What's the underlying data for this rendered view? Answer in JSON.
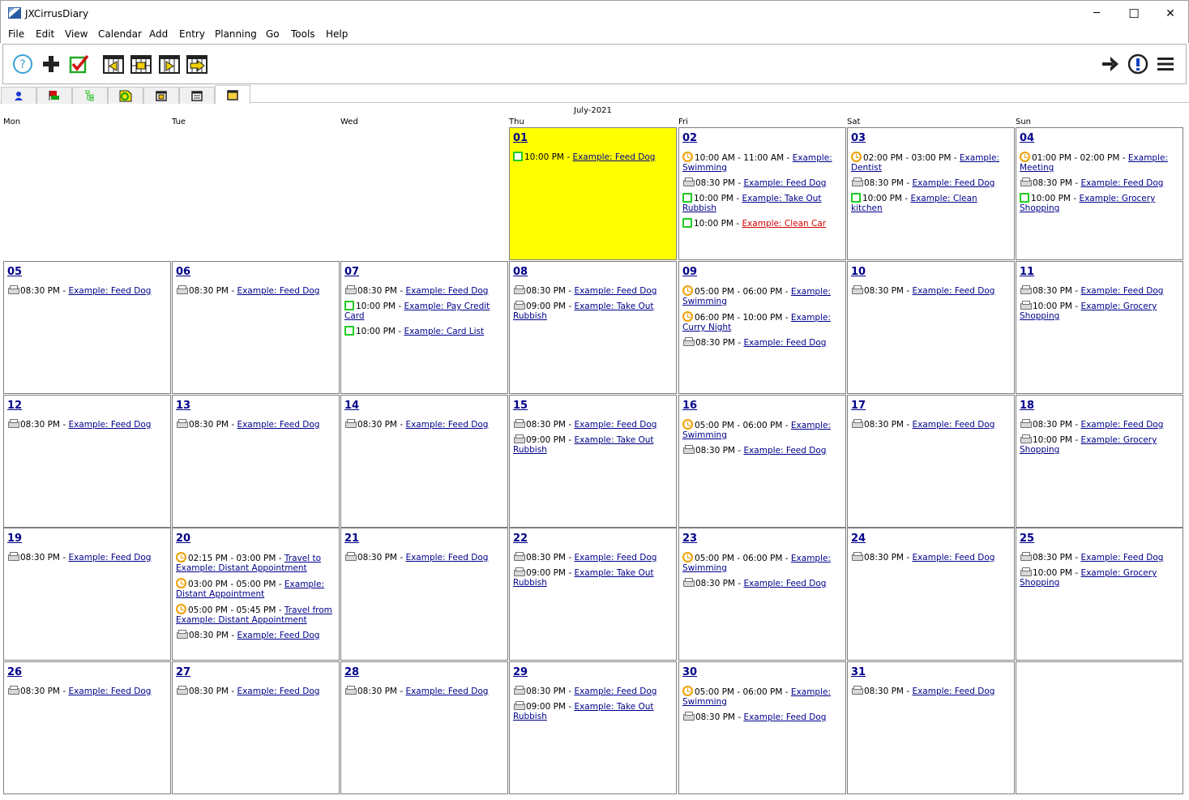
{
  "window": {
    "title": "JXCirrusDiary",
    "minimize": "─",
    "maximize": "☐",
    "close": "✕"
  },
  "menu": [
    "File",
    "Edit",
    "View",
    "Calendar",
    "Add",
    "Entry",
    "Planning",
    "Go",
    "Tools",
    "Help"
  ],
  "toolbar": {
    "left": [
      "help-icon",
      "add-icon",
      "check-icon",
      "week-back-icon",
      "week-calendar-icon",
      "week-forward-icon",
      "go-today-icon"
    ],
    "right": [
      "arrow-right-icon",
      "alert-icon",
      "menu-icon"
    ]
  },
  "tabs": [
    "person-icon",
    "flag-icon",
    "tree-icon",
    "note-icon",
    "day-icon",
    "week-icon",
    "month-icon"
  ],
  "calendar": {
    "month_label": "July-2021",
    "day_names": [
      "Mon",
      "Tue",
      "Wed",
      "Thu",
      "Fri",
      "Sat",
      "Sun"
    ],
    "today": "01",
    "cells": [
      {
        "col": 3,
        "row": 0,
        "day": "01",
        "events": [
          {
            "icon": "check",
            "time": "10:00 PM - ",
            "title": "Example: Feed Dog"
          }
        ]
      },
      {
        "col": 4,
        "row": 0,
        "day": "02",
        "events": [
          {
            "icon": "clock",
            "time": "10:00 AM - 11:00 AM - ",
            "title": "Example: Swimming"
          },
          {
            "icon": "printer",
            "time": "08:30 PM - ",
            "title": "Example: Feed Dog"
          },
          {
            "icon": "check",
            "time": "10:00 PM - ",
            "title": "Example: Take Out Rubbish"
          },
          {
            "icon": "check",
            "time": "10:00 PM - ",
            "title": "Example: Clean Car",
            "red": true
          }
        ]
      },
      {
        "col": 5,
        "row": 0,
        "day": "03",
        "events": [
          {
            "icon": "clock",
            "time": "02:00 PM - 03:00 PM - ",
            "title": "Example: Dentist"
          },
          {
            "icon": "printer",
            "time": "08:30 PM - ",
            "title": "Example: Feed Dog"
          },
          {
            "icon": "check",
            "time": "10:00 PM - ",
            "title": "Example: Clean kitchen"
          }
        ]
      },
      {
        "col": 6,
        "row": 0,
        "day": "04",
        "events": [
          {
            "icon": "clock",
            "time": "01:00 PM - 02:00 PM - ",
            "title": "Example: Meeting"
          },
          {
            "icon": "printer",
            "time": "08:30 PM - ",
            "title": "Example: Feed Dog"
          },
          {
            "icon": "check",
            "time": "10:00 PM - ",
            "title": "Example: Grocery Shopping"
          }
        ]
      },
      {
        "col": 0,
        "row": 1,
        "day": "05",
        "events": [
          {
            "icon": "printer",
            "time": "08:30 PM - ",
            "title": "Example: Feed Dog"
          }
        ]
      },
      {
        "col": 1,
        "row": 1,
        "day": "06",
        "events": [
          {
            "icon": "printer",
            "time": "08:30 PM - ",
            "title": "Example: Feed Dog"
          }
        ]
      },
      {
        "col": 2,
        "row": 1,
        "day": "07",
        "events": [
          {
            "icon": "printer",
            "time": "08:30 PM - ",
            "title": "Example: Feed Dog"
          },
          {
            "icon": "check",
            "time": "10:00 PM - ",
            "title": "Example: Pay Credit Card"
          },
          {
            "icon": "check",
            "time": "10:00 PM - ",
            "title": "Example: Card List"
          }
        ]
      },
      {
        "col": 3,
        "row": 1,
        "day": "08",
        "events": [
          {
            "icon": "printer",
            "time": "08:30 PM - ",
            "title": "Example: Feed Dog"
          },
          {
            "icon": "printer",
            "time": "09:00 PM - ",
            "title": "Example: Take Out Rubbish"
          }
        ]
      },
      {
        "col": 4,
        "row": 1,
        "day": "09",
        "events": [
          {
            "icon": "clock",
            "time": "05:00 PM - 06:00 PM - ",
            "title": "Example: Swimming"
          },
          {
            "icon": "clock",
            "time": "06:00 PM - 10:00 PM - ",
            "title": "Example: Curry Night"
          },
          {
            "icon": "printer",
            "time": "08:30 PM - ",
            "title": "Example: Feed Dog"
          }
        ]
      },
      {
        "col": 5,
        "row": 1,
        "day": "10",
        "events": [
          {
            "icon": "printer",
            "time": "08:30 PM - ",
            "title": "Example: Feed Dog"
          }
        ]
      },
      {
        "col": 6,
        "row": 1,
        "day": "11",
        "events": [
          {
            "icon": "printer",
            "time": "08:30 PM - ",
            "title": "Example: Feed Dog"
          },
          {
            "icon": "printer",
            "time": "10:00 PM - ",
            "title": "Example: Grocery Shopping"
          }
        ]
      },
      {
        "col": 0,
        "row": 2,
        "day": "12",
        "events": [
          {
            "icon": "printer",
            "time": "08:30 PM - ",
            "title": "Example: Feed Dog"
          }
        ]
      },
      {
        "col": 1,
        "row": 2,
        "day": "13",
        "events": [
          {
            "icon": "printer",
            "time": "08:30 PM - ",
            "title": "Example: Feed Dog"
          }
        ]
      },
      {
        "col": 2,
        "row": 2,
        "day": "14",
        "events": [
          {
            "icon": "printer",
            "time": "08:30 PM - ",
            "title": "Example: Feed Dog"
          }
        ]
      },
      {
        "col": 3,
        "row": 2,
        "day": "15",
        "events": [
          {
            "icon": "printer",
            "time": "08:30 PM - ",
            "title": "Example: Feed Dog"
          },
          {
            "icon": "printer",
            "time": "09:00 PM - ",
            "title": "Example: Take Out Rubbish"
          }
        ]
      },
      {
        "col": 4,
        "row": 2,
        "day": "16",
        "events": [
          {
            "icon": "clock",
            "time": "05:00 PM - 06:00 PM - ",
            "title": "Example: Swimming"
          },
          {
            "icon": "printer",
            "time": "08:30 PM - ",
            "title": "Example: Feed Dog"
          }
        ]
      },
      {
        "col": 5,
        "row": 2,
        "day": "17",
        "events": [
          {
            "icon": "printer",
            "time": "08:30 PM - ",
            "title": "Example: Feed Dog"
          }
        ]
      },
      {
        "col": 6,
        "row": 2,
        "day": "18",
        "events": [
          {
            "icon": "printer",
            "time": "08:30 PM - ",
            "title": "Example: Feed Dog"
          },
          {
            "icon": "printer",
            "time": "10:00 PM - ",
            "title": "Example: Grocery Shopping"
          }
        ]
      },
      {
        "col": 0,
        "row": 3,
        "day": "19",
        "events": [
          {
            "icon": "printer",
            "time": "08:30 PM - ",
            "title": "Example: Feed Dog"
          }
        ]
      },
      {
        "col": 1,
        "row": 3,
        "day": "20",
        "events": [
          {
            "icon": "clock",
            "time": "02:15 PM - 03:00 PM - ",
            "title": "Travel to Example: Distant Appointment"
          },
          {
            "icon": "clock",
            "time": "03:00 PM - 05:00 PM - ",
            "title": "Example: Distant Appointment"
          },
          {
            "icon": "clock",
            "time": "05:00 PM - 05:45 PM - ",
            "title": "Travel from Example: Distant Appointment"
          },
          {
            "icon": "printer",
            "time": "08:30 PM - ",
            "title": "Example: Feed Dog"
          }
        ]
      },
      {
        "col": 2,
        "row": 3,
        "day": "21",
        "events": [
          {
            "icon": "printer",
            "time": "08:30 PM - ",
            "title": "Example: Feed Dog"
          }
        ]
      },
      {
        "col": 3,
        "row": 3,
        "day": "22",
        "events": [
          {
            "icon": "printer",
            "time": "08:30 PM - ",
            "title": "Example: Feed Dog"
          },
          {
            "icon": "printer",
            "time": "09:00 PM - ",
            "title": "Example: Take Out Rubbish"
          }
        ]
      },
      {
        "col": 4,
        "row": 3,
        "day": "23",
        "events": [
          {
            "icon": "clock",
            "time": "05:00 PM - 06:00 PM - ",
            "title": "Example: Swimming"
          },
          {
            "icon": "printer",
            "time": "08:30 PM - ",
            "title": "Example: Feed Dog"
          }
        ]
      },
      {
        "col": 5,
        "row": 3,
        "day": "24",
        "events": [
          {
            "icon": "printer",
            "time": "08:30 PM - ",
            "title": "Example: Feed Dog"
          }
        ]
      },
      {
        "col": 6,
        "row": 3,
        "day": "25",
        "events": [
          {
            "icon": "printer",
            "time": "08:30 PM - ",
            "title": "Example: Feed Dog"
          },
          {
            "icon": "printer",
            "time": "10:00 PM - ",
            "title": "Example: Grocery Shopping"
          }
        ]
      },
      {
        "col": 0,
        "row": 4,
        "day": "26",
        "events": [
          {
            "icon": "printer",
            "time": "08:30 PM - ",
            "title": "Example: Feed Dog"
          }
        ]
      },
      {
        "col": 1,
        "row": 4,
        "day": "27",
        "events": [
          {
            "icon": "printer",
            "time": "08:30 PM - ",
            "title": "Example: Feed Dog"
          }
        ]
      },
      {
        "col": 2,
        "row": 4,
        "day": "28",
        "events": [
          {
            "icon": "printer",
            "time": "08:30 PM - ",
            "title": "Example: Feed Dog"
          }
        ]
      },
      {
        "col": 3,
        "row": 4,
        "day": "29",
        "events": [
          {
            "icon": "printer",
            "time": "08:30 PM - ",
            "title": "Example: Feed Dog"
          },
          {
            "icon": "printer",
            "time": "09:00 PM - ",
            "title": "Example: Take Out Rubbish"
          }
        ]
      },
      {
        "col": 4,
        "row": 4,
        "day": "30",
        "events": [
          {
            "icon": "clock",
            "time": "05:00 PM - 06:00 PM - ",
            "title": "Example: Swimming"
          },
          {
            "icon": "printer",
            "time": "08:30 PM - ",
            "title": "Example: Feed Dog"
          }
        ]
      },
      {
        "col": 5,
        "row": 4,
        "day": "31",
        "events": [
          {
            "icon": "printer",
            "time": "08:30 PM - ",
            "title": "Example: Feed Dog"
          }
        ]
      }
    ]
  }
}
